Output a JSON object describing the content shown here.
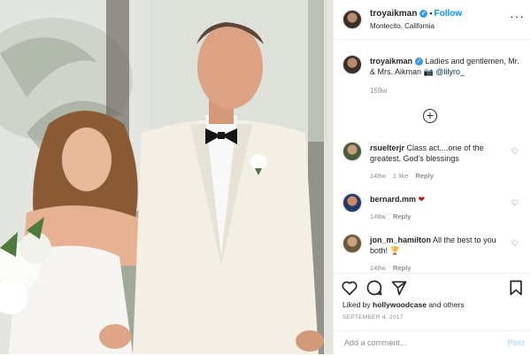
{
  "post": {
    "username": "troyaikman",
    "follow_label": "Follow",
    "separator": "•",
    "location": "Montecito, California",
    "more_icon": "more-horizontal-icon"
  },
  "caption": {
    "username": "troyaikman",
    "text": "Ladies and gentlemen, Mr. & Mrs. Aikman 📷 ",
    "mention": "@lilyro_",
    "time": "159w"
  },
  "load_more_icon": "plus-circle-icon",
  "comments": [
    {
      "username": "rsuelterjr",
      "text": "Class act....one of the greatest. God's blessings",
      "time": "148w",
      "likes": "1 like",
      "reply": "Reply"
    },
    {
      "username": "bernard.mm",
      "text": "❤",
      "time": "148w",
      "likes": "",
      "reply": "Reply"
    },
    {
      "username": "jon_m_hamilton",
      "text": "All the best to you both! 🏆",
      "time": "148w",
      "likes": "",
      "reply": "Reply"
    }
  ],
  "actions": {
    "liked_by_prefix": "Liked by ",
    "liked_by_user": "hollywoodcase",
    "liked_by_suffix": " and others",
    "date": "SEPTEMBER 4, 2017"
  },
  "add_comment": {
    "placeholder": "Add a comment...",
    "post_label": "Post"
  },
  "colors": {
    "link_blue": "#0095f6",
    "verified_blue": "#3897f0",
    "muted_text": "#8e8e8e"
  }
}
